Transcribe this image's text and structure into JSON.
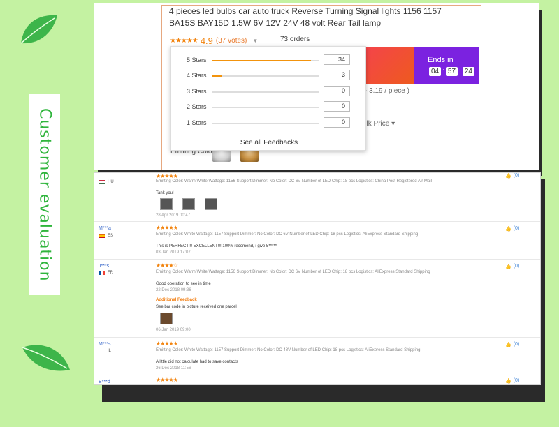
{
  "side_title": "Customer evaluation",
  "product": {
    "title": "4 pieces led bulbs car auto truck Reverse Turning Signal lights 1156 1157 BA15S BAY15D 1.5W 6V 12V 24V 48 volt Rear Tail lamp",
    "rating_stars": "★★★★★",
    "rating_value": "4.9",
    "votes": "(37 votes)",
    "orders": "73 orders",
    "ends_in_label": "Ends in",
    "timer": [
      "04",
      "57",
      "24"
    ],
    "price_range_fragment": "- 3.19 / piece )",
    "bulk_price": "ulk Price",
    "emitting_color_label": "Emitting Color:"
  },
  "rating_breakdown": {
    "rows": [
      {
        "label": "5 Stars",
        "count": "34",
        "fraction": 0.92
      },
      {
        "label": "4 Stars",
        "count": "3",
        "fraction": 0.09
      },
      {
        "label": "3 Stars",
        "count": "0",
        "fraction": 0
      },
      {
        "label": "2 Stars",
        "count": "0",
        "fraction": 0
      },
      {
        "label": "1 Stars",
        "count": "0",
        "fraction": 0
      }
    ],
    "see_all": "See all Feedbacks"
  },
  "reviews": [
    {
      "name": "",
      "country": "HU",
      "stars": "★★★★★",
      "attrs": "Emitting Color: Warm White    Wattage: 1156    Support Dimmer: No    Color: DC 6V    Number of LED Chip: 18 pcs    Logistics: China Post Registered Air Mail",
      "text": "Tank you!",
      "date": "28 Apr 2019 00:47",
      "likes": "(0)"
    },
    {
      "name": "M***a",
      "country": "ES",
      "stars": "★★★★★",
      "attrs": "Emitting Color: White    Wattage: 1157    Support Dimmer: No    Color: DC 6V    Number of LED Chip: 18 pcs    Logistics: AliExpress Standard Shipping",
      "text": "This is PERFECT!!! EXCELLENT!!! 100% recomend, i give 5*****",
      "date": "03 Jan 2019 17:07",
      "likes": "(0)"
    },
    {
      "name": "J***s",
      "country": "FR",
      "stars": "★★★★☆",
      "attrs": "Emitting Color: Warm White    Wattage: 1156    Support Dimmer: No    Color: DC 6V    Number of LED Chip: 18 pcs    Logistics: AliExpress Standard Shipping",
      "text": "Good operation to see in time",
      "date": "22 Dec 2018 09:36",
      "additional_label": "Additional Feedback",
      "additional_text": "See bar code in picture received one parcel",
      "additional_date": "06 Jan 2019 09:00",
      "likes": "(0)"
    },
    {
      "name": "M***s",
      "country": "IL",
      "stars": "★★★★★",
      "attrs": "Emitting Color: White    Wattage: 1157    Support Dimmer: No    Color: DC 48V    Number of LED Chip: 18 pcs    Logistics: AliExpress Standard Shipping",
      "text": "A little did not calculate had to save contacts",
      "date": "26 Dec 2018 11:56",
      "likes": "(0)"
    },
    {
      "name": "B***d",
      "country": "",
      "stars": "★★★★★",
      "likes": "(0)"
    }
  ],
  "colors": {
    "background": "#c4f2a2",
    "accent_green": "#2fb53c",
    "star_orange": "#f2830d",
    "promo_purple": "#7b22e0"
  },
  "icons": [
    "leaf-icon",
    "thumbs-up-icon",
    "chevron-down-icon",
    "flag-icon"
  ]
}
